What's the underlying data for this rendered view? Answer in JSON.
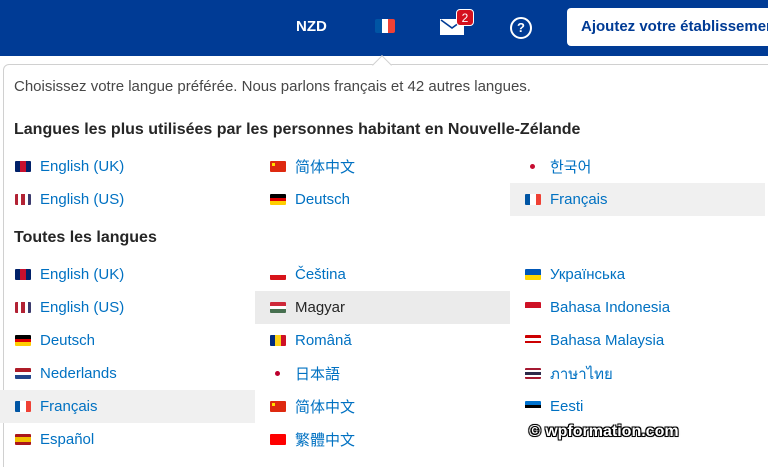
{
  "header": {
    "currency": "NZD",
    "language_flag_icon": "flag-france-icon",
    "messages_badge": "2",
    "help_label": "?",
    "cta_label": "Ajoutez votre établissement"
  },
  "panel": {
    "intro": "Choisissez votre langue préférée. Nous parlons français et 42 autres langues.",
    "suggested_heading": "Langues les plus utilisées par les personnes habitant en Nouvelle-Zélande",
    "all_heading": "Toutes les langues",
    "suggested": [
      {
        "label": "English (UK)",
        "flag": "uk"
      },
      {
        "label": "简体中文",
        "flag": "cn"
      },
      {
        "label": "한국어",
        "flag": "kr"
      },
      {
        "label": "English (US)",
        "flag": "us"
      },
      {
        "label": "Deutsch",
        "flag": "de"
      },
      {
        "label": "Français",
        "flag": "fr",
        "state": "selected"
      }
    ],
    "all": [
      {
        "label": "English (UK)",
        "flag": "uk"
      },
      {
        "label": "Čeština",
        "flag": "cz"
      },
      {
        "label": "Українська",
        "flag": "ua"
      },
      {
        "label": "English (US)",
        "flag": "us"
      },
      {
        "label": "Magyar",
        "flag": "hu",
        "state": "hover"
      },
      {
        "label": "Bahasa Indonesia",
        "flag": "id"
      },
      {
        "label": "Deutsch",
        "flag": "de"
      },
      {
        "label": "Română",
        "flag": "ro"
      },
      {
        "label": "Bahasa Malaysia",
        "flag": "my"
      },
      {
        "label": "Nederlands",
        "flag": "nl"
      },
      {
        "label": "日本語",
        "flag": "jp"
      },
      {
        "label": "ภาษาไทย",
        "flag": "th"
      },
      {
        "label": "Français",
        "flag": "fr",
        "state": "selected"
      },
      {
        "label": "简体中文",
        "flag": "cn"
      },
      {
        "label": "Eesti",
        "flag": "ee"
      },
      {
        "label": "Español",
        "flag": "es"
      },
      {
        "label": "繁體中文",
        "flag": "tw"
      }
    ]
  },
  "watermark": "© wpformation.com",
  "colors": {
    "header_bg": "#003b95",
    "link": "#0071c2",
    "badge": "#d4111e"
  }
}
